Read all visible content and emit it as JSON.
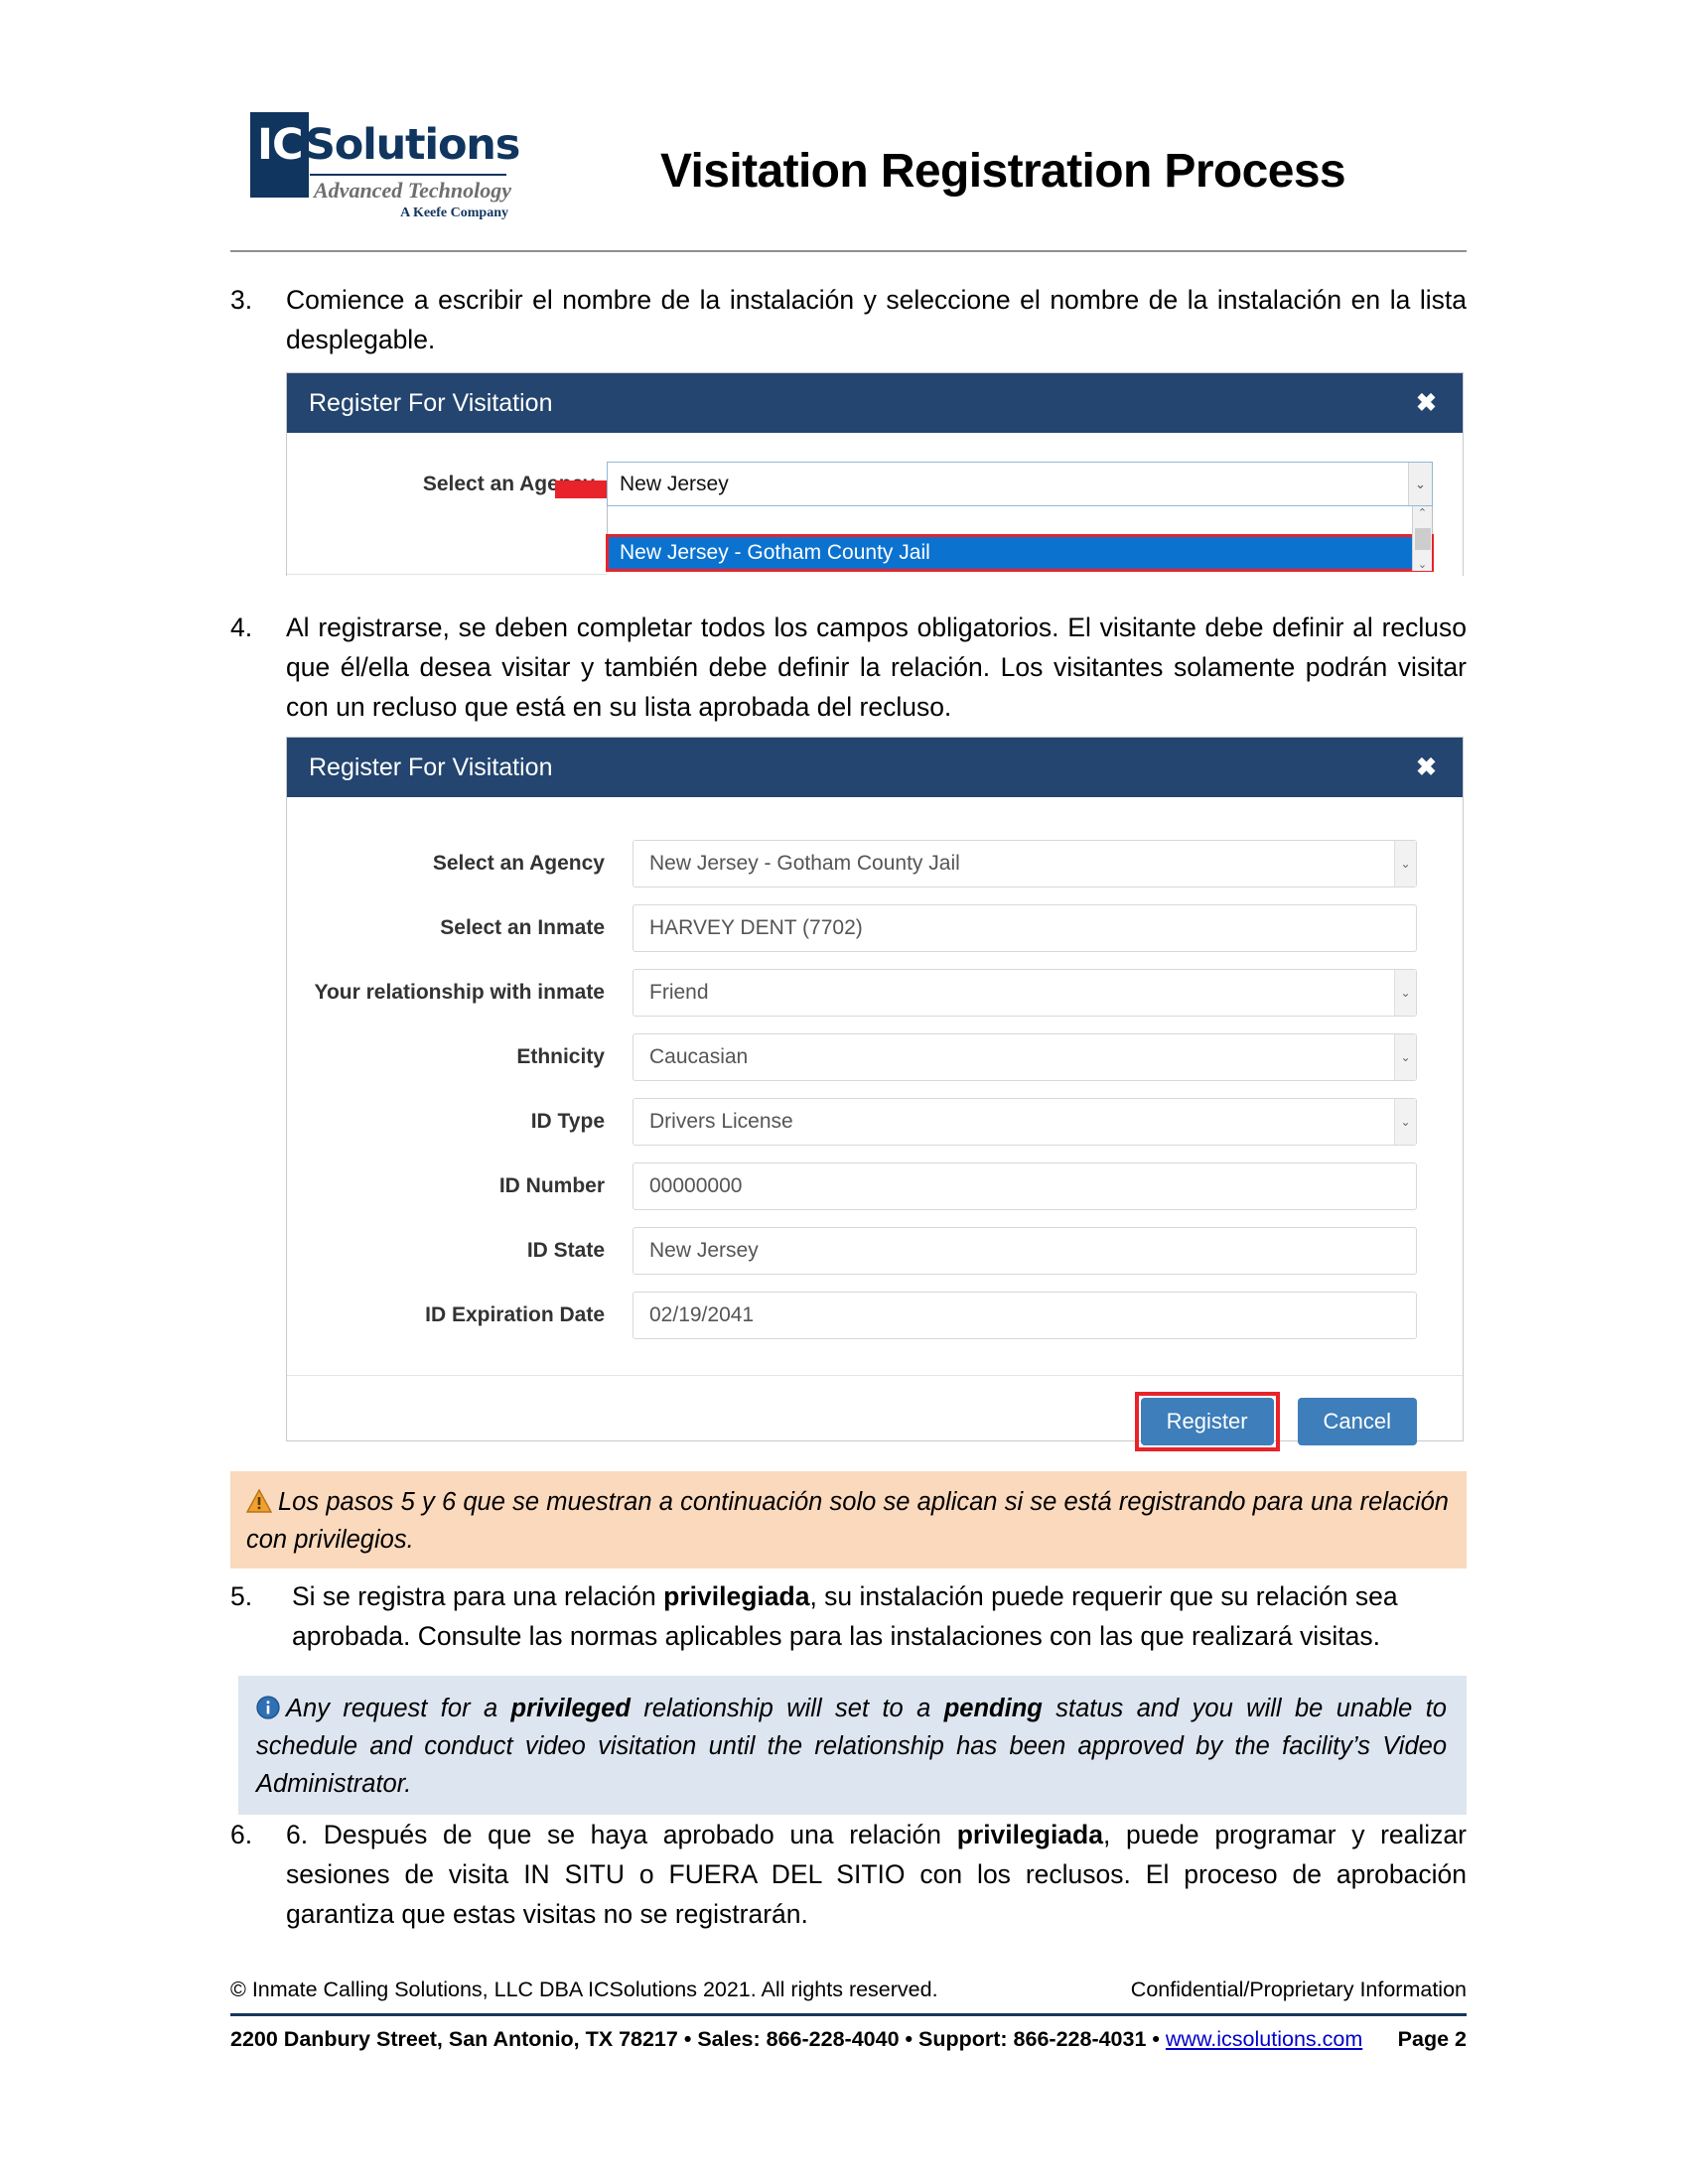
{
  "header": {
    "logo": {
      "ic": "IC",
      "solutions": "Solutions",
      "tagline": "Advanced Technology",
      "keefe": "A Keefe Company"
    },
    "title": "Visitation Registration Process"
  },
  "steps": {
    "step3": {
      "number": "3.",
      "text": "Comience a escribir el nombre de la instalación y seleccione el nombre de la instalación en la lista desplegable."
    },
    "step4": {
      "number": "4.",
      "text": "Al registrarse, se deben completar todos los campos obligatorios. El visitante debe definir al recluso que él/ella desea visitar y también debe definir la relación. Los visitantes solamente podrán visitar con un recluso que está en su lista aprobada del recluso."
    },
    "step5": {
      "number": "5.",
      "text_before": "Si se registra para una relación ",
      "bold": "privilegiada",
      "text_after": ", su instalación puede requerir que su relación sea aprobada. Consulte las normas aplicables para las instalaciones con las que realizará visitas."
    },
    "step6": {
      "number": "6.",
      "text_before": "6. Después de que se haya aprobado una relación ",
      "bold": "privilegiada",
      "text_after": ", puede programar y realizar sesiones de visita IN SITU o FUERA DEL SITIO con los reclusos. El proceso de aprobación garantiza que estas visitas no se registrarán."
    }
  },
  "dialog1": {
    "title": "Register For Visitation",
    "close_label": "✖",
    "field_label": "Select an Agency",
    "combo_value": "New Jersey",
    "dropdown_options": [
      "",
      "New Jersey - Gotham County Jail"
    ],
    "selected_option": "New Jersey - Gotham County Jail",
    "caret_glyph": "⌄",
    "scroll_up_glyph": "⌃",
    "scroll_down_glyph": "⌄",
    "highlight_color": "#e8232a",
    "arrow_color": "#e8232a",
    "selection_color": "#0b72d0"
  },
  "dialog2": {
    "title": "Register For Visitation",
    "close_label": "✖",
    "caret_glyph": "⌄",
    "fields": [
      {
        "label": "Select an Agency",
        "value": "New Jersey - Gotham County Jail",
        "has_caret": true
      },
      {
        "label": "Select an Inmate",
        "value": "HARVEY DENT (7702)",
        "has_caret": false
      },
      {
        "label": "Your relationship with inmate",
        "value": "Friend",
        "has_caret": true
      },
      {
        "label": "Ethnicity",
        "value": "Caucasian",
        "has_caret": true
      },
      {
        "label": "ID Type",
        "value": "Drivers License",
        "has_caret": true
      },
      {
        "label": "ID Number",
        "value": "00000000",
        "has_caret": false
      },
      {
        "label": "ID State",
        "value": "New Jersey",
        "has_caret": false
      },
      {
        "label": "ID Expiration Date",
        "value": "02/19/2041",
        "has_caret": false
      }
    ],
    "register_label": "Register",
    "cancel_label": "Cancel",
    "button_color": "#3d7ebb",
    "header_color": "#23456f"
  },
  "warning_box": {
    "icon": "warning-triangle-icon",
    "text": "Los pasos 5 y 6 que se muestran a continuación solo se aplican si se está registrando para una relación con privilegios.",
    "background": "#fbd9bd"
  },
  "info_box": {
    "icon": "info-circle-icon",
    "part1": "Any request for a ",
    "bold1": "privileged",
    "part2": " relationship will set to a ",
    "bold2": "pending",
    "part3": " status and you will be unable to schedule and conduct video visitation until the relationship has been approved by the facility’s Video Administrator.",
    "background": "#dde5f0"
  },
  "footer": {
    "copyright": "© Inmate Calling Solutions, LLC DBA ICSolutions 2021. All rights reserved.",
    "confidential": "Confidential/Proprietary Information",
    "address": "2200 Danbury Street, San Antonio, TX  78217 • Sales: 866-228-4040 • Support: 866-228-4031 • ",
    "link": "www.icsolutions.com",
    "page": "Page 2"
  }
}
